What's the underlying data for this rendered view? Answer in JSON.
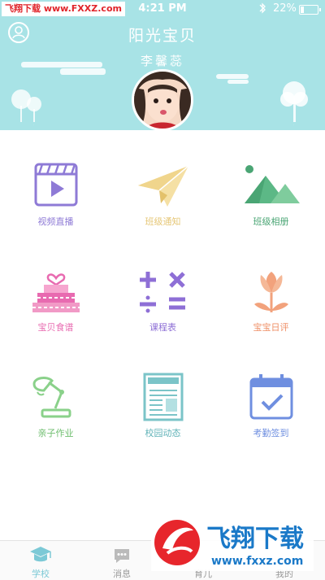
{
  "status_bar": {
    "watermark": "飞翔下载 www.FXXZ.com",
    "time": "4:21 PM",
    "battery_percent": "22%",
    "battery_level": 0.22,
    "bluetooth_icon": "bluetooth-icon"
  },
  "header": {
    "title": "阳光宝贝",
    "child_name": "李馨蕊",
    "profile_icon": "user-profile-icon"
  },
  "features": [
    {
      "label": "视频直播",
      "icon": "video-play-icon",
      "color": "#8e7ad6"
    },
    {
      "label": "班级通知",
      "icon": "paper-plane-icon",
      "color": "#f0d58c"
    },
    {
      "label": "班级相册",
      "icon": "mountain-photo-icon",
      "color": "#5cb886"
    },
    {
      "label": "宝贝食谱",
      "icon": "cake-icon",
      "color": "#e86ab0"
    },
    {
      "label": "课程表",
      "icon": "math-symbols-icon",
      "color": "#8e6fd6"
    },
    {
      "label": "宝宝日评",
      "icon": "tulip-icon",
      "color": "#f2a27c"
    },
    {
      "label": "亲子作业",
      "icon": "desk-lamp-icon",
      "color": "#8ad18a"
    },
    {
      "label": "校园动态",
      "icon": "newspaper-icon",
      "color": "#7bc4c8"
    },
    {
      "label": "考勤签到",
      "icon": "calendar-check-icon",
      "color": "#6f8fe0"
    }
  ],
  "tabs": [
    {
      "label": "学校",
      "icon": "graduation-cap-icon",
      "active": true
    },
    {
      "label": "消息",
      "icon": "chat-bubble-icon",
      "active": false
    },
    {
      "label": "育儿",
      "icon": "parenting-icon",
      "active": false
    },
    {
      "label": "我的",
      "icon": "me-icon",
      "active": false
    }
  ],
  "colors": {
    "header_bg": "#a8e3e6",
    "tab_active": "#7cc9d6",
    "tab_inactive": "#999999"
  }
}
